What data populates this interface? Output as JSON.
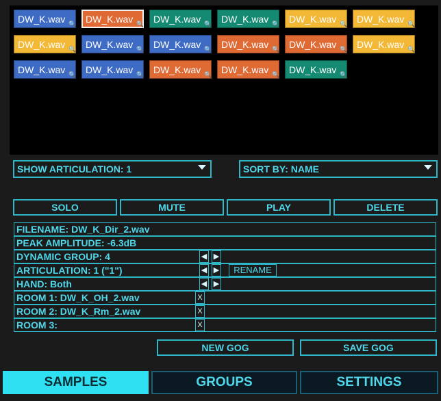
{
  "samples": [
    {
      "label": "DW_K.wav",
      "color": "#3e6cc4",
      "selected": false
    },
    {
      "label": "DW_K.wav",
      "color": "#e06a34",
      "selected": true
    },
    {
      "label": "DW_K.wav",
      "color": "#148a72",
      "selected": false
    },
    {
      "label": "DW_K.wav",
      "color": "#148a72",
      "selected": false
    },
    {
      "label": "DW_K.wav",
      "color": "#f2b836",
      "selected": false
    },
    {
      "label": "DW_K.wav",
      "color": "#f2b836",
      "selected": false
    },
    {
      "label": "DW_K.wav",
      "color": "#f2b836",
      "selected": false
    },
    {
      "label": "DW_K.wav",
      "color": "#3e6cc4",
      "selected": false
    },
    {
      "label": "DW_K.wav",
      "color": "#3e6cc4",
      "selected": false
    },
    {
      "label": "DW_K.wav",
      "color": "#e06a34",
      "selected": false
    },
    {
      "label": "DW_K.wav",
      "color": "#e06a34",
      "selected": false
    },
    {
      "label": "DW_K.wav",
      "color": "#f2b836",
      "selected": false
    },
    {
      "label": "DW_K.wav",
      "color": "#3e6cc4",
      "selected": false
    },
    {
      "label": "DW_K.wav",
      "color": "#3e6cc4",
      "selected": false
    },
    {
      "label": "DW_K.wav",
      "color": "#e06a34",
      "selected": false
    },
    {
      "label": "DW_K.wav",
      "color": "#e06a34",
      "selected": false
    },
    {
      "label": "DW_K.wav",
      "color": "#148a72",
      "selected": false
    }
  ],
  "controls": {
    "show_articulation": "SHOW ARTICULATION: 1",
    "sort_by": "SORT BY: NAME"
  },
  "buttons": {
    "solo": "SOLO",
    "mute": "MUTE",
    "play": "PLAY",
    "delete": "DELETE",
    "new_gog": "NEW GOG",
    "save_gog": "SAVE GOG"
  },
  "info": {
    "filename": "FILENAME: DW_K_Dir_2.wav",
    "peak": "PEAK AMPLITUDE: -6.3dB",
    "dynamic_group": "DYNAMIC GROUP: 4",
    "articulation": "ARTICULATION: 1 (\"1\")",
    "hand": "HAND: Both",
    "room1": "ROOM 1: DW_K_OH_2.wav",
    "room2": "ROOM 2: DW_K_Rm_2.wav",
    "room3": "ROOM 3:",
    "rename": "RENAME",
    "clear_x": "X",
    "prev_glyph": "◀",
    "next_glyph": "▶"
  },
  "tabs": {
    "samples": "SAMPLES",
    "groups": "GROUPS",
    "settings": "SETTINGS"
  },
  "colors": {
    "accent": "#2fb6c8",
    "text": "#4fd7ea",
    "active_tab": "#2fe0f2"
  }
}
